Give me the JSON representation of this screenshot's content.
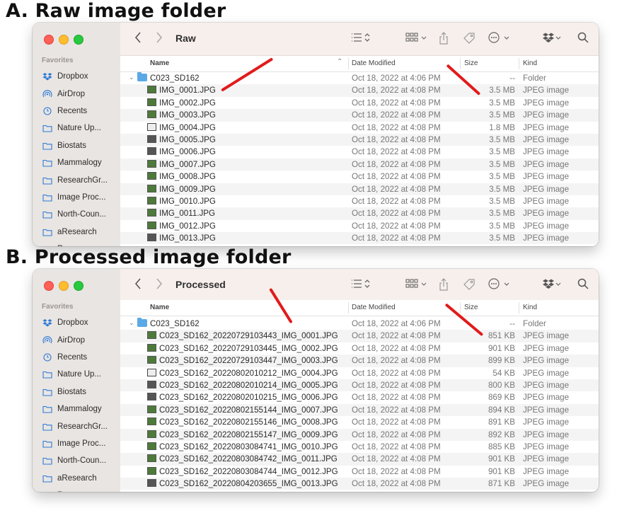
{
  "panels": [
    {
      "label": "A. Raw image folder",
      "window": {
        "title": "Raw",
        "favorites_label": "Favorites",
        "sidebar": [
          {
            "label": "Dropbox",
            "icon": "dropbox-icon"
          },
          {
            "label": "AirDrop",
            "icon": "airdrop-icon"
          },
          {
            "label": "Recents",
            "icon": "clock-icon"
          },
          {
            "label": "Nature Up...",
            "icon": "folder-icon"
          },
          {
            "label": "Biostats",
            "icon": "folder-icon"
          },
          {
            "label": "Mammalogy",
            "icon": "folder-icon"
          },
          {
            "label": "ResearchGr...",
            "icon": "folder-icon"
          },
          {
            "label": "Image Proc...",
            "icon": "folder-icon"
          },
          {
            "label": "North-Coun...",
            "icon": "folder-icon"
          },
          {
            "label": "aResearch",
            "icon": "folder-icon"
          },
          {
            "label": "R...",
            "icon": "folder-icon"
          }
        ],
        "columns": {
          "name": "Name",
          "date": "Date Modified",
          "size": "Size",
          "kind": "Kind"
        },
        "folder": {
          "name": "C023_SD162",
          "date": "Oct 18, 2022 at 4:06 PM",
          "size": "--",
          "kind": "Folder"
        },
        "files": [
          {
            "name": "IMG_0001.JPG",
            "date": "Oct 18, 2022 at 4:08 PM",
            "size": "3.5 MB",
            "kind": "JPEG image",
            "thumb": "green"
          },
          {
            "name": "IMG_0002.JPG",
            "date": "Oct 18, 2022 at 4:08 PM",
            "size": "3.5 MB",
            "kind": "JPEG image",
            "thumb": "green"
          },
          {
            "name": "IMG_0003.JPG",
            "date": "Oct 18, 2022 at 4:08 PM",
            "size": "3.5 MB",
            "kind": "JPEG image",
            "thumb": "green"
          },
          {
            "name": "IMG_0004.JPG",
            "date": "Oct 18, 2022 at 4:08 PM",
            "size": "1.8 MB",
            "kind": "JPEG image",
            "thumb": "light"
          },
          {
            "name": "IMG_0005.JPG",
            "date": "Oct 18, 2022 at 4:08 PM",
            "size": "3.5 MB",
            "kind": "JPEG image",
            "thumb": "dark"
          },
          {
            "name": "IMG_0006.JPG",
            "date": "Oct 18, 2022 at 4:08 PM",
            "size": "3.5 MB",
            "kind": "JPEG image",
            "thumb": "dark"
          },
          {
            "name": "IMG_0007.JPG",
            "date": "Oct 18, 2022 at 4:08 PM",
            "size": "3.5 MB",
            "kind": "JPEG image",
            "thumb": "green"
          },
          {
            "name": "IMG_0008.JPG",
            "date": "Oct 18, 2022 at 4:08 PM",
            "size": "3.5 MB",
            "kind": "JPEG image",
            "thumb": "green"
          },
          {
            "name": "IMG_0009.JPG",
            "date": "Oct 18, 2022 at 4:08 PM",
            "size": "3.5 MB",
            "kind": "JPEG image",
            "thumb": "green"
          },
          {
            "name": "IMG_0010.JPG",
            "date": "Oct 18, 2022 at 4:08 PM",
            "size": "3.5 MB",
            "kind": "JPEG image",
            "thumb": "green"
          },
          {
            "name": "IMG_0011.JPG",
            "date": "Oct 18, 2022 at 4:08 PM",
            "size": "3.5 MB",
            "kind": "JPEG image",
            "thumb": "green"
          },
          {
            "name": "IMG_0012.JPG",
            "date": "Oct 18, 2022 at 4:08 PM",
            "size": "3.5 MB",
            "kind": "JPEG image",
            "thumb": "green"
          },
          {
            "name": "IMG_0013.JPG",
            "date": "Oct 18, 2022 at 4:08 PM",
            "size": "3.5 MB",
            "kind": "JPEG image",
            "thumb": "dark"
          }
        ]
      }
    },
    {
      "label": "B. Processed image folder",
      "window": {
        "title": "Processed",
        "favorites_label": "Favorites",
        "sidebar": [
          {
            "label": "Dropbox",
            "icon": "dropbox-icon"
          },
          {
            "label": "AirDrop",
            "icon": "airdrop-icon"
          },
          {
            "label": "Recents",
            "icon": "clock-icon"
          },
          {
            "label": "Nature Up...",
            "icon": "folder-icon"
          },
          {
            "label": "Biostats",
            "icon": "folder-icon"
          },
          {
            "label": "Mammalogy",
            "icon": "folder-icon"
          },
          {
            "label": "ResearchGr...",
            "icon": "folder-icon"
          },
          {
            "label": "Image Proc...",
            "icon": "folder-icon"
          },
          {
            "label": "North-Coun...",
            "icon": "folder-icon"
          },
          {
            "label": "aResearch",
            "icon": "folder-icon"
          },
          {
            "label": "R...",
            "icon": "folder-icon"
          }
        ],
        "columns": {
          "name": "Name",
          "date": "Date Modified",
          "size": "Size",
          "kind": "Kind"
        },
        "folder": {
          "name": "C023_SD162",
          "date": "Oct 18, 2022 at 4:06 PM",
          "size": "--",
          "kind": "Folder"
        },
        "files": [
          {
            "name": "C023_SD162_20220729103443_IMG_0001.JPG",
            "date": "Oct 18, 2022 at 4:08 PM",
            "size": "851 KB",
            "kind": "JPEG image",
            "thumb": "green"
          },
          {
            "name": "C023_SD162_20220729103445_IMG_0002.JPG",
            "date": "Oct 18, 2022 at 4:08 PM",
            "size": "901 KB",
            "kind": "JPEG image",
            "thumb": "green"
          },
          {
            "name": "C023_SD162_20220729103447_IMG_0003.JPG",
            "date": "Oct 18, 2022 at 4:08 PM",
            "size": "899 KB",
            "kind": "JPEG image",
            "thumb": "green"
          },
          {
            "name": "C023_SD162_20220802010212_IMG_0004.JPG",
            "date": "Oct 18, 2022 at 4:08 PM",
            "size": "54 KB",
            "kind": "JPEG image",
            "thumb": "light"
          },
          {
            "name": "C023_SD162_20220802010214_IMG_0005.JPG",
            "date": "Oct 18, 2022 at 4:08 PM",
            "size": "800 KB",
            "kind": "JPEG image",
            "thumb": "dark"
          },
          {
            "name": "C023_SD162_20220802010215_IMG_0006.JPG",
            "date": "Oct 18, 2022 at 4:08 PM",
            "size": "869 KB",
            "kind": "JPEG image",
            "thumb": "dark"
          },
          {
            "name": "C023_SD162_20220802155144_IMG_0007.JPG",
            "date": "Oct 18, 2022 at 4:08 PM",
            "size": "894 KB",
            "kind": "JPEG image",
            "thumb": "green"
          },
          {
            "name": "C023_SD162_20220802155146_IMG_0008.JPG",
            "date": "Oct 18, 2022 at 4:08 PM",
            "size": "891 KB",
            "kind": "JPEG image",
            "thumb": "green"
          },
          {
            "name": "C023_SD162_20220802155147_IMG_0009.JPG",
            "date": "Oct 18, 2022 at 4:08 PM",
            "size": "892 KB",
            "kind": "JPEG image",
            "thumb": "green"
          },
          {
            "name": "C023_SD162_20220803084741_IMG_0010.JPG",
            "date": "Oct 18, 2022 at 4:08 PM",
            "size": "885 KB",
            "kind": "JPEG image",
            "thumb": "green"
          },
          {
            "name": "C023_SD162_20220803084742_IMG_0011.JPG",
            "date": "Oct 18, 2022 at 4:08 PM",
            "size": "901 KB",
            "kind": "JPEG image",
            "thumb": "green"
          },
          {
            "name": "C023_SD162_20220803084744_IMG_0012.JPG",
            "date": "Oct 18, 2022 at 4:08 PM",
            "size": "901 KB",
            "kind": "JPEG image",
            "thumb": "green"
          },
          {
            "name": "C023_SD162_20220804203655_IMG_0013.JPG",
            "date": "Oct 18, 2022 at 4:08 PM",
            "size": "871 KB",
            "kind": "JPEG image",
            "thumb": "dark"
          }
        ]
      }
    }
  ]
}
